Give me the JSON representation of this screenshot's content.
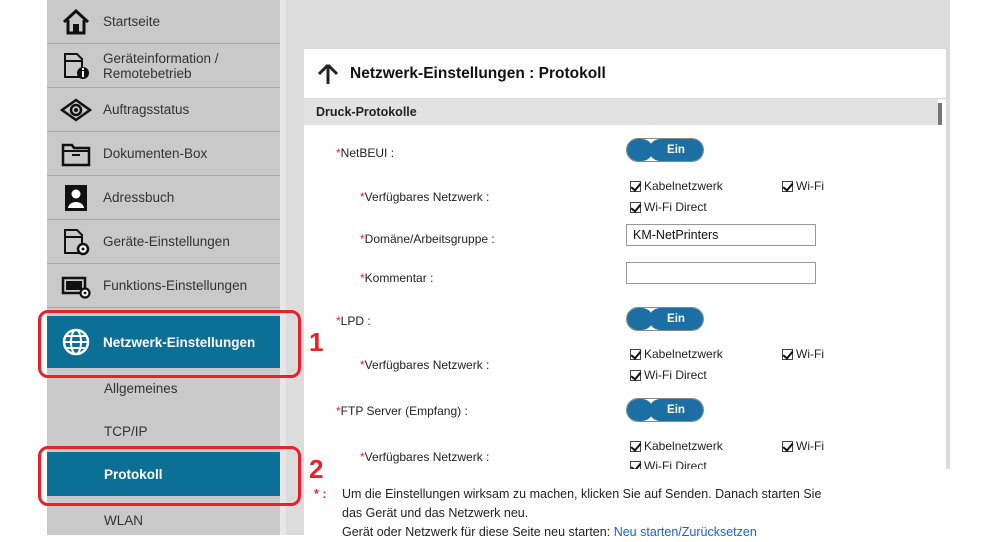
{
  "sidebar": {
    "items": [
      {
        "label": "Startseite",
        "icon": "home-icon"
      },
      {
        "label": "Geräteinformation / Remotebetrieb",
        "icon": "device-info-icon"
      },
      {
        "label": "Auftragsstatus",
        "icon": "eye-icon"
      },
      {
        "label": "Dokumenten-Box",
        "icon": "folder-icon"
      },
      {
        "label": "Adressbuch",
        "icon": "address-book-icon"
      },
      {
        "label": "Geräte-Einstellungen",
        "icon": "device-settings-icon"
      },
      {
        "label": "Funktions-Einstellungen",
        "icon": "function-settings-icon"
      },
      {
        "label": "Netzwerk-Einstellungen",
        "icon": "globe-icon",
        "active": true
      }
    ],
    "subitems": [
      {
        "label": "Allgemeines"
      },
      {
        "label": "TCP/IP"
      },
      {
        "label": "Protokoll",
        "active": true
      },
      {
        "label": "WLAN"
      }
    ]
  },
  "page": {
    "title": "Netzwerk-Einstellungen : Protokoll",
    "section": "Druck-Protokolle"
  },
  "rows": {
    "netbeui_label": "NetBEUI :",
    "netbeui_toggle": "Ein",
    "net1_label": "Verfügbares Netzwerk :",
    "domain_label": "Domäne/Arbeitsgruppe :",
    "domain_value": "KM-NetPrinters",
    "comment_label": "Kommentar :",
    "comment_value": "",
    "lpd_label": "LPD :",
    "lpd_toggle": "Ein",
    "net2_label": "Verfügbares Netzwerk :",
    "ftp_label": "FTP Server (Empfang) :",
    "ftp_toggle": "Ein",
    "net3_label": "Verfügbares Netzwerk :",
    "chk_wired": "Kabelnetzwerk",
    "chk_wifi": "Wi-Fi",
    "chk_wifidirect": "Wi-Fi Direct",
    "asterisk": "*"
  },
  "footer": {
    "marker": "* :",
    "line1": "Um die Einstellungen wirksam zu machen, klicken Sie auf Senden. Danach starten Sie",
    "line2": "das Gerät und das Netzwerk neu.",
    "line3_prefix": "Gerät oder Netzwerk für diese Seite neu starten:",
    "line3_link": "Neu starten/Zurücksetzen"
  },
  "callouts": {
    "one": "1",
    "two": "2"
  },
  "colors": {
    "accent": "#0c6f96",
    "toggle": "#1b6fa3",
    "callout": "#e8202a",
    "link": "#1a62c7"
  }
}
